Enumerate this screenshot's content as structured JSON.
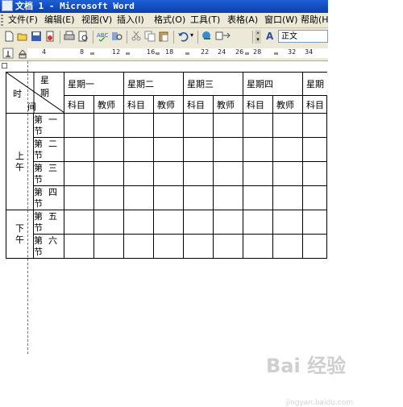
{
  "window": {
    "title": "文档 1 - Microsoft Word"
  },
  "menu": [
    "文件(F)",
    "编辑(E)",
    "视图(V)",
    "插入(I)",
    "格式(O)",
    "工具(T)",
    "表格(A)",
    "窗口(W)",
    "帮助(H)"
  ],
  "toolbar": {
    "style_value": "正文",
    "font_glyph": "A"
  },
  "ruler": {
    "numbers": [
      "4",
      "8",
      "12",
      "16",
      "18",
      "22",
      "24",
      "26",
      "28",
      "32",
      "34"
    ]
  },
  "table": {
    "corner_top": "星　期",
    "corner_bottom_char": "间",
    "corner_left_char": "时",
    "days": [
      "星期一",
      "星期二",
      "星期三",
      "星期四",
      "星期"
    ],
    "subheaders": [
      "科目",
      "教师"
    ],
    "sessions": [
      {
        "label": "上午",
        "periods": [
          [
            "第",
            "一",
            "节"
          ],
          [
            "第",
            "二",
            "节"
          ],
          [
            "第",
            "三",
            "节"
          ],
          [
            "第",
            "四",
            "节"
          ]
        ]
      },
      {
        "label": "下午",
        "periods": [
          [
            "第",
            "五",
            "节"
          ],
          [
            "第",
            "六",
            "节"
          ]
        ]
      }
    ]
  },
  "watermark": {
    "text": "Bai 经验",
    "url": "jingyan.baidu.com"
  }
}
